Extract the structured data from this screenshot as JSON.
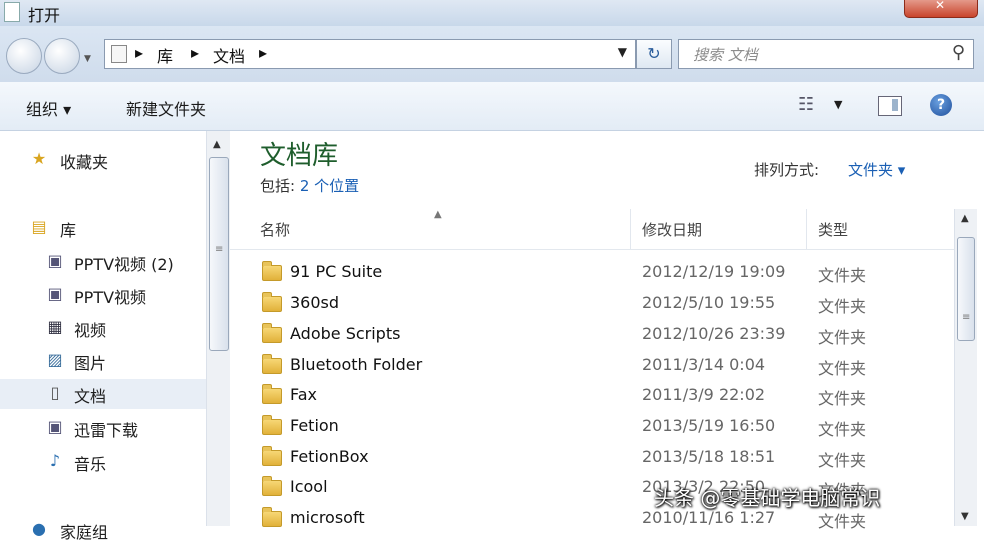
{
  "window": {
    "title": "打开"
  },
  "address": {
    "segments": [
      "库",
      "文档"
    ],
    "separator": "▸"
  },
  "search": {
    "placeholder": "搜索 文档"
  },
  "toolbar": {
    "organize": "组织 ▾",
    "new_folder": "新建文件夹"
  },
  "nav": {
    "items": [
      {
        "label": "收藏夹",
        "icon": "star-icon"
      },
      {
        "label": "库",
        "icon": "library-icon"
      },
      {
        "label": "PPTV视频 (2)",
        "icon": "document-library-icon"
      },
      {
        "label": "PPTV视频",
        "icon": "document-library-icon"
      },
      {
        "label": "视频",
        "icon": "video-icon"
      },
      {
        "label": "图片",
        "icon": "picture-icon"
      },
      {
        "label": "文档",
        "icon": "document-icon"
      },
      {
        "label": "迅雷下载",
        "icon": "document-library-icon"
      },
      {
        "label": "音乐",
        "icon": "music-icon"
      },
      {
        "label": "家庭组",
        "icon": "homegroup-icon"
      }
    ],
    "selected": "文档"
  },
  "library": {
    "title": "文档库",
    "includes_label": "包括:",
    "includes_link": "2 个位置",
    "arrange_label": "排列方式:",
    "arrange_value": "文件夹 ▾"
  },
  "columns": {
    "name": "名称",
    "date": "修改日期",
    "type": "类型"
  },
  "files": [
    {
      "name": "91 PC Suite",
      "date": "2012/12/19 19:09",
      "type": "文件夹"
    },
    {
      "name": "360sd",
      "date": "2012/5/10 19:55",
      "type": "文件夹"
    },
    {
      "name": "Adobe Scripts",
      "date": "2012/10/26 23:39",
      "type": "文件夹"
    },
    {
      "name": "Bluetooth Folder",
      "date": "2011/3/14 0:04",
      "type": "文件夹"
    },
    {
      "name": "Fax",
      "date": "2011/3/9 22:02",
      "type": "文件夹"
    },
    {
      "name": "Fetion",
      "date": "2013/5/19 16:50",
      "type": "文件夹"
    },
    {
      "name": "FetionBox",
      "date": "2013/5/18 18:51",
      "type": "文件夹"
    },
    {
      "name": "Icool",
      "date": "2013/3/2 22:50",
      "type": "文件夹"
    },
    {
      "name": "microsoft",
      "date": "2010/11/16 1:27",
      "type": "文件夹"
    }
  ],
  "watermark": "头条 @零基础学电脑常识"
}
